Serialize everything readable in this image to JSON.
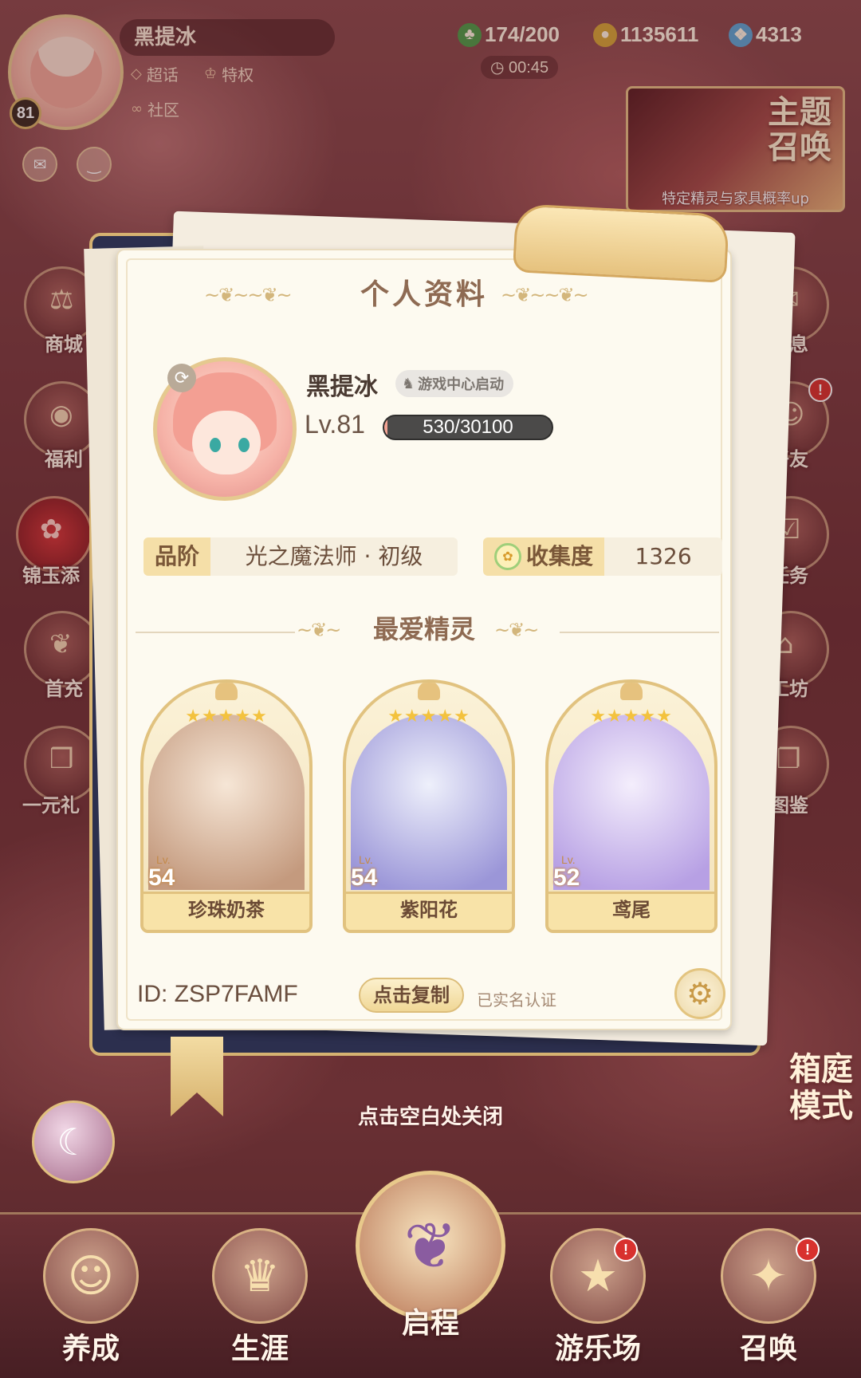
{
  "hud": {
    "player_name": "黑提冰",
    "player_level": "81",
    "links": {
      "chaohua": "超话",
      "privilege": "特权",
      "community": "社区"
    },
    "resources": {
      "stamina": "174/200",
      "gold": "1135611",
      "diamond": "4313"
    },
    "timer": "00:45"
  },
  "theme_summon": {
    "title_line1": "主题",
    "title_line2": "召唤",
    "subtitle": "特定精灵与家具概率up"
  },
  "left_nav": [
    {
      "label": "商城"
    },
    {
      "label": "福利"
    },
    {
      "label": "锦玉添"
    },
    {
      "label": "首充"
    },
    {
      "label": "一元礼"
    }
  ],
  "right_nav": [
    {
      "label": "息"
    },
    {
      "label": "好友",
      "badge": "!"
    },
    {
      "label": "任务"
    },
    {
      "label": "工坊"
    },
    {
      "label": "图鉴"
    }
  ],
  "modal": {
    "title": "个人资料",
    "name": "黑提冰",
    "tag": "游戏中心启动",
    "level": "Lv.81",
    "exp": "530/30100",
    "exp_progress": 0.0176,
    "rank_label": "品阶",
    "rank_value": "光之魔法师 · 初级",
    "collection_label": "收集度",
    "collection_value": "1326",
    "favorites_title": "最爱精灵",
    "spirits": [
      {
        "name": "珍珠奶茶",
        "level": "54",
        "lv_label": "Lv.",
        "stars": "★★★★★",
        "color_top": "#f6e6d6",
        "color_bottom": "#c49a7e"
      },
      {
        "name": "紫阳花",
        "level": "54",
        "lv_label": "Lv.",
        "stars": "★★★★★",
        "color_top": "#eef0fb",
        "color_bottom": "#9b96d8"
      },
      {
        "name": "鸢尾",
        "level": "52",
        "lv_label": "Lv.",
        "stars": "★★★★★",
        "color_top": "#f4eefc",
        "color_bottom": "#b7a0e4"
      }
    ],
    "id_text": "ID:  ZSP7FAMF",
    "copy_label": "点击复制",
    "verified": "已实名认证"
  },
  "close_hint": "点击空白处关闭",
  "garden": {
    "line1": "箱庭",
    "line2": "模式"
  },
  "bottom_tabs": [
    {
      "label": "养成"
    },
    {
      "label": "生涯"
    },
    {
      "label": "启程"
    },
    {
      "label": "游乐场",
      "badge": "!"
    },
    {
      "label": "召唤",
      "badge": "!"
    }
  ],
  "colors": {
    "accent_gold": "#e1c27f",
    "badge_red": "#d8312e",
    "bg_dark": "#2c2f4e"
  }
}
